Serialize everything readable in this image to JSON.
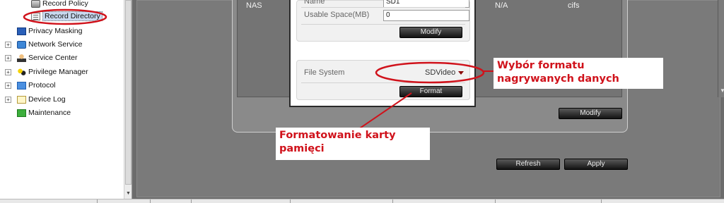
{
  "tree": {
    "items": [
      {
        "label": "Record Policy",
        "icon": "disk-icon"
      },
      {
        "label": "Record Directory",
        "icon": "list-icon",
        "selected": true
      },
      {
        "label": "Privacy Masking",
        "icon": "mask-icon"
      },
      {
        "label": "Network Service",
        "icon": "network-icon"
      },
      {
        "label": "Service Center",
        "icon": "person-icon"
      },
      {
        "label": "Privilege Manager",
        "icon": "users-icon"
      },
      {
        "label": "Protocol",
        "icon": "protocol-icon"
      },
      {
        "label": "Device Log",
        "icon": "log-icon"
      },
      {
        "label": "Maintenance",
        "icon": "maintenance-icon"
      }
    ]
  },
  "disk_table": {
    "row": {
      "type": "NAS",
      "status": "N/A",
      "fs": "cifs"
    }
  },
  "dialog": {
    "name_label": "Name",
    "name_value": "SD1",
    "usable_space_label": "Usable Space(MB)",
    "usable_space_value": "0",
    "modify_label": "Modify",
    "file_system_label": "File System",
    "file_system_value": "SDVideo",
    "format_label": "Format"
  },
  "panel": {
    "modify_label": "Modify",
    "refresh_label": "Refresh",
    "apply_label": "Apply"
  },
  "annotations": {
    "format_choice_line1": "Wybór formatu",
    "format_choice_line2": "nagrywanych danych",
    "format_card_line1": "Formatowanie karty",
    "format_card_line2": "pamięci",
    "color": "#d0121b"
  },
  "colors": {
    "annotation_red": "#d0121b",
    "selected_row": "#c9d9f0",
    "dark_button": "#1a1a1a"
  }
}
